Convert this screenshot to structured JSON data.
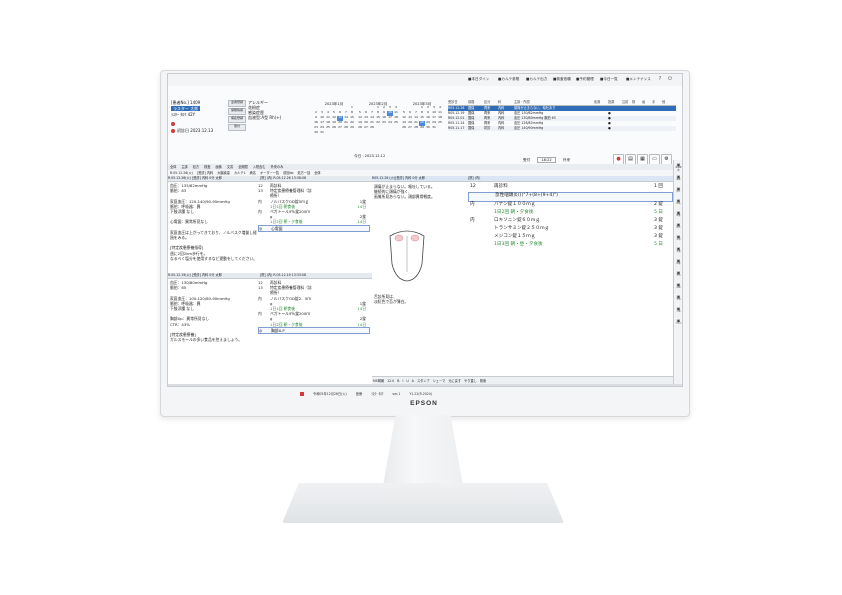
{
  "brand": "EPSON",
  "topbar": {
    "items": [
      "■本日ダイン",
      "■カルテ参照",
      "■カルテ出力",
      "■検査依頼",
      "■予約管理",
      "■今日一覧",
      "■メンテナンス"
    ]
  },
  "patient": {
    "id_label": "[患者No.]",
    "id": "1409",
    "name": "ラスター 太郎",
    "kana": "ﾗｽﾀｰ ﾀﾛｳ",
    "age": "42Y",
    "note": "初診日 2023.12.13"
  },
  "side_buttons": [
    "患者登録",
    "保険情報",
    "病名登録",
    "受付"
  ],
  "info": {
    "lines": [
      "アレルギー",
      "花粉症",
      "感染症歴",
      "血液型:A型 Rh(+)"
    ]
  },
  "calendars": [
    {
      "title": "2023年1月",
      "days": [
        "",
        "",
        "",
        "",
        "",
        "",
        "1",
        "2",
        "3",
        "4",
        "5",
        "6",
        "7",
        "8",
        "9",
        "10",
        "11",
        "12",
        "13",
        "14",
        "15",
        "16",
        "17",
        "18",
        "19",
        "20",
        "21",
        "22",
        "23",
        "24",
        "25",
        "26",
        "27",
        "28",
        "29",
        "30",
        "31"
      ],
      "highlight": "13"
    },
    {
      "title": "2023年2月",
      "days": [
        "",
        "",
        "",
        "1",
        "2",
        "3",
        "4",
        "5",
        "6",
        "7",
        "8",
        "9",
        "10",
        "11",
        "12",
        "13",
        "14",
        "15",
        "16",
        "17",
        "18",
        "19",
        "20",
        "21",
        "22",
        "23",
        "24",
        "25",
        "26",
        "27",
        "28"
      ],
      "highlight": "10"
    },
    {
      "title": "2023年3月",
      "days": [
        "",
        "",
        "",
        "1",
        "2",
        "3",
        "4",
        "5",
        "6",
        "7",
        "8",
        "9",
        "10",
        "11",
        "12",
        "13",
        "14",
        "15",
        "16",
        "17",
        "18",
        "19",
        "20",
        "21",
        "22",
        "23",
        "24",
        "25",
        "26",
        "27",
        "28",
        "29",
        "30",
        "31"
      ],
      "highlight": "22"
    }
  ],
  "today_label": "今日 : 2023.12.12",
  "appointments": {
    "headers": [
      "受診日",
      "保険",
      "区分",
      "科",
      "主訴・所見",
      "処置",
      "投薬",
      "注射",
      "検",
      "画",
      "手",
      "他"
    ],
    "rows": [
      {
        "cells": [
          "R05.12.26",
          "国保",
          "再来",
          "内科",
          "頭痛が止まらない。嘔吐あり",
          "",
          "",
          "",
          "",
          "",
          "",
          ""
        ],
        "style": "sel"
      },
      {
        "cells": [
          "R05.12.19",
          "国保",
          "再来",
          "内科",
          "血圧 130/82mmHg",
          "",
          "●",
          "",
          "",
          "",
          "",
          ""
        ],
        "style": ""
      },
      {
        "cells": [
          "R05.12.01",
          "国保",
          "再来",
          "内科",
          "血圧 130/80mmHg 脈拍 63",
          "",
          "●",
          "",
          "",
          "",
          "",
          ""
        ],
        "style": "alt"
      },
      {
        "cells": [
          "R05.11.24",
          "国保",
          "再来",
          "内科",
          "血圧 126/82mmHg",
          "",
          "●",
          "",
          "",
          "",
          "",
          ""
        ],
        "style": ""
      },
      {
        "cells": [
          "R05.11.17",
          "国保",
          "初診",
          "内科",
          "血圧 140/90mmHg",
          "",
          "●",
          "",
          "",
          "",
          "",
          ""
        ],
        "style": "alt"
      }
    ]
  },
  "status_small": [
    "受付",
    "18:22",
    "外来"
  ],
  "strip_tabs": [
    "全体",
    "主訴",
    "処方",
    "検査",
    "画像",
    "文書",
    "全期間",
    "入院含む",
    "外来のみ"
  ],
  "strip2": [
    "R.05.12.26(火)",
    "[受診] 内科",
    "大腸疾患",
    "カルテ1",
    "病名",
    "オーダー一覧",
    "前回do",
    "処方一括",
    "全体"
  ],
  "left_entries": [
    {
      "header": "R.05.12.26(火) [受診] 内科 0分 太郎",
      "rx_header": "[院] (内)  R.05.12.26 13:38:08",
      "notes": [
        "血圧：135/82mmHg",
        "脈拍：63",
        "",
        "家庭血圧：120-140/90-95mmHg",
        "脈拍：呼吸器：異",
        "下肢浮腫 なし",
        "",
        "心電図：異常所見なし",
        "",
        "家庭血圧は上がってきており、ノルバスク増量し経",
        "過をみる。",
        "",
        "[特定疾患療養指導]",
        "週に2回2km歩行を。",
        "なるべく塩分を使用するなど運動をしてください。"
      ],
      "rx": [
        {
          "code": "12",
          "text": "再診料",
          "qty": ""
        },
        {
          "code": "13",
          "text": "特定疾患療養管理料（診",
          "qty": ""
        },
        {
          "code": "",
          "text": "療所）",
          "qty": ""
        },
        {
          "code": "内",
          "text": "ノルバスクOD錠5ｍｇ",
          "qty": "1錠"
        },
        {
          "code": "",
          "text": "1日1回 朝食後",
          "qty": "14日",
          "green": true
        },
        {
          "code": "内",
          "text": "ペガトール5％錠200ｍ",
          "qty": ""
        },
        {
          "code": "",
          "text": "g",
          "qty": "2錠"
        },
        {
          "code": "",
          "text": "1日2回 朝・夕食後",
          "qty": "14日",
          "green": true
        },
        {
          "code": "◎",
          "text": "心電図",
          "qty": "",
          "boxed": true
        }
      ]
    },
    {
      "header": "R.05.12.19(火) [受診] 内科 0分 太郎",
      "rx_header": "[院] (内)  R.05.12.19 13:33:08",
      "notes": [
        "血圧：130/80mmHg",
        "脈拍：65",
        "",
        "家庭血圧：100-120/80-90mmHg",
        "脈拍：呼吸器：異",
        "下肢浮腫 なし",
        "",
        "胸部Xp：異常所見なし",
        "CTR：43%",
        "",
        "[特定疾患療養]",
        "ガルスモールの多い食品を控えましょう。"
      ],
      "rx": [
        {
          "code": "12",
          "text": "再診料",
          "qty": ""
        },
        {
          "code": "13",
          "text": "特定疾患療養管理料（診",
          "qty": ""
        },
        {
          "code": "",
          "text": "療所）",
          "qty": ""
        },
        {
          "code": "内",
          "text": "ノルバスクOD錠2．5ｍ",
          "qty": ""
        },
        {
          "code": "",
          "text": "g",
          "qty": "1錠"
        },
        {
          "code": "",
          "text": "1日1回 朝食後",
          "qty": "14日",
          "green": true
        },
        {
          "code": "内",
          "text": "ペガトール5％錠200ｍ",
          "qty": ""
        },
        {
          "code": "",
          "text": "g",
          "qty": "2錠"
        },
        {
          "code": "",
          "text": "1日2回 朝・夕食後",
          "qty": "14日",
          "green": true
        },
        {
          "code": "◎",
          "text": "胸部X-P",
          "qty": "",
          "boxed": true
        }
      ]
    }
  ],
  "middle": {
    "header": "R05.12.26 (火)[受診] 内科 0分 太郎",
    "top_lines": [
      "頭痛が止まらない。嘔吐している。",
      "継続的に頭痛が強く、",
      "画像所見あらない。頭部異常軽度。"
    ],
    "bottom_lines": [
      "舌診所見は、",
      "淡紅色で苔が薄白。"
    ]
  },
  "right": {
    "header": "[院] (内)",
    "lines": [
      {
        "code": "12",
        "text": "再診料",
        "qty": "1 回"
      },
      {
        "code": "",
        "text": "急性咽頭炎(((\"7+(8+(9+4)\")",
        "qty": "",
        "boxed": true
      },
      {
        "code": "内",
        "text": "バナン錠１００ｍｇ",
        "qty": "2 錠"
      },
      {
        "code": "",
        "text": "1日2回 朝・夕食後",
        "qty": "5 日",
        "green": true
      },
      {
        "code": "内",
        "text": "ロキソニン錠６０ｍｇ",
        "qty": "3 錠"
      },
      {
        "code": "",
        "text": "トランサミン錠２５０ｍｇ",
        "qty": "3 錠"
      },
      {
        "code": "",
        "text": "メジコン錠１５ｍｇ",
        "qty": "3 錠"
      },
      {
        "code": "",
        "text": "1日3回 朝・昼・夕食後",
        "qty": "5 日",
        "green": true
      }
    ]
  },
  "right_toolbar": [
    "医事連携",
    "画像",
    "紹介",
    "病名",
    "検査",
    "処方",
    "注射",
    "文書",
    "処置",
    "予約",
    "記録",
    "手術",
    "入院",
    "ヘルプ"
  ],
  "bottom_toolbar": [
    "MS明朝",
    "12.0",
    "B",
    "I",
    "U",
    "A",
    "スタンプ",
    "シェーマ",
    "元に戻す",
    "やり直し",
    "検索"
  ],
  "taskbar": [
    "令和05年12月26日(火)",
    "医療",
    "ﾗｽﾀｰ ﾀﾛｳ",
    "ver.1",
    "Y1.22(R.2024)"
  ]
}
